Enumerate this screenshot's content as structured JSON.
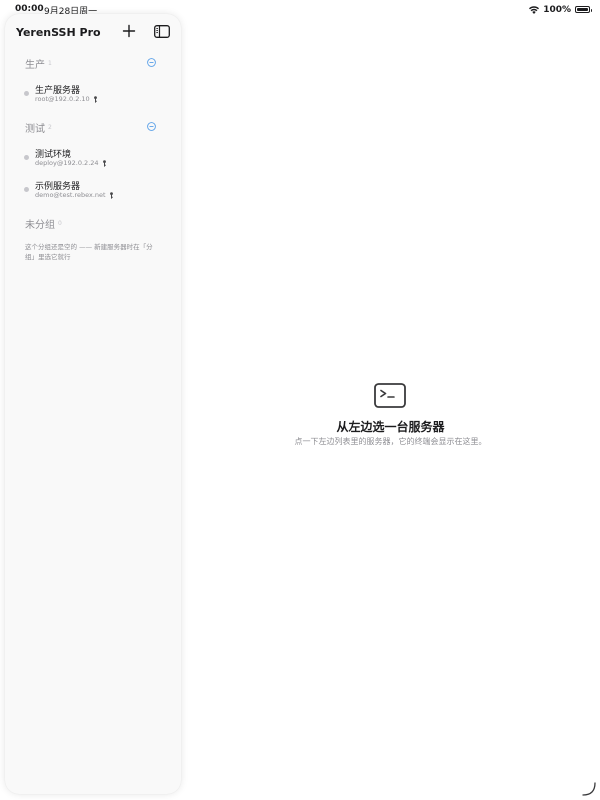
{
  "status_bar": {
    "time": "00:00",
    "date": "9月28日周一",
    "battery": "100%"
  },
  "sidebar": {
    "title": "YerenSSH Pro",
    "groups": [
      {
        "name": "生产",
        "count": "1",
        "servers": [
          {
            "name": "生产服务器",
            "address": "root@192.0.2.10"
          }
        ]
      },
      {
        "name": "测试",
        "count": "2",
        "servers": [
          {
            "name": "测试环境",
            "address": "deploy@192.0.2.24"
          },
          {
            "name": "示例服务器",
            "address": "demo@test.rebex.net"
          }
        ]
      },
      {
        "name": "未分组",
        "count": "0",
        "empty_hint": "这个分组还是空的 —— 新建服务器时在「分组」里选它就行"
      }
    ]
  },
  "main": {
    "empty_title": "从左边选一台服务器",
    "empty_subtitle": "点一下左边列表里的服务器，它的终端会显示在这里。"
  },
  "icons": {
    "status": [
      "wifi-icon",
      "battery-icon"
    ],
    "sidebar": [
      "plus-icon",
      "sidebar-icon",
      "minus-circle-icon",
      "key-icon",
      "status-dot"
    ],
    "main": [
      "terminal-icon",
      "resize-corner-icon"
    ]
  },
  "colors": {
    "accent": "#5aa0e8",
    "sidebar_bg": "#f9f9f9",
    "secondary_text": "#8e8e93",
    "status_dot": "#c7c7cc"
  }
}
